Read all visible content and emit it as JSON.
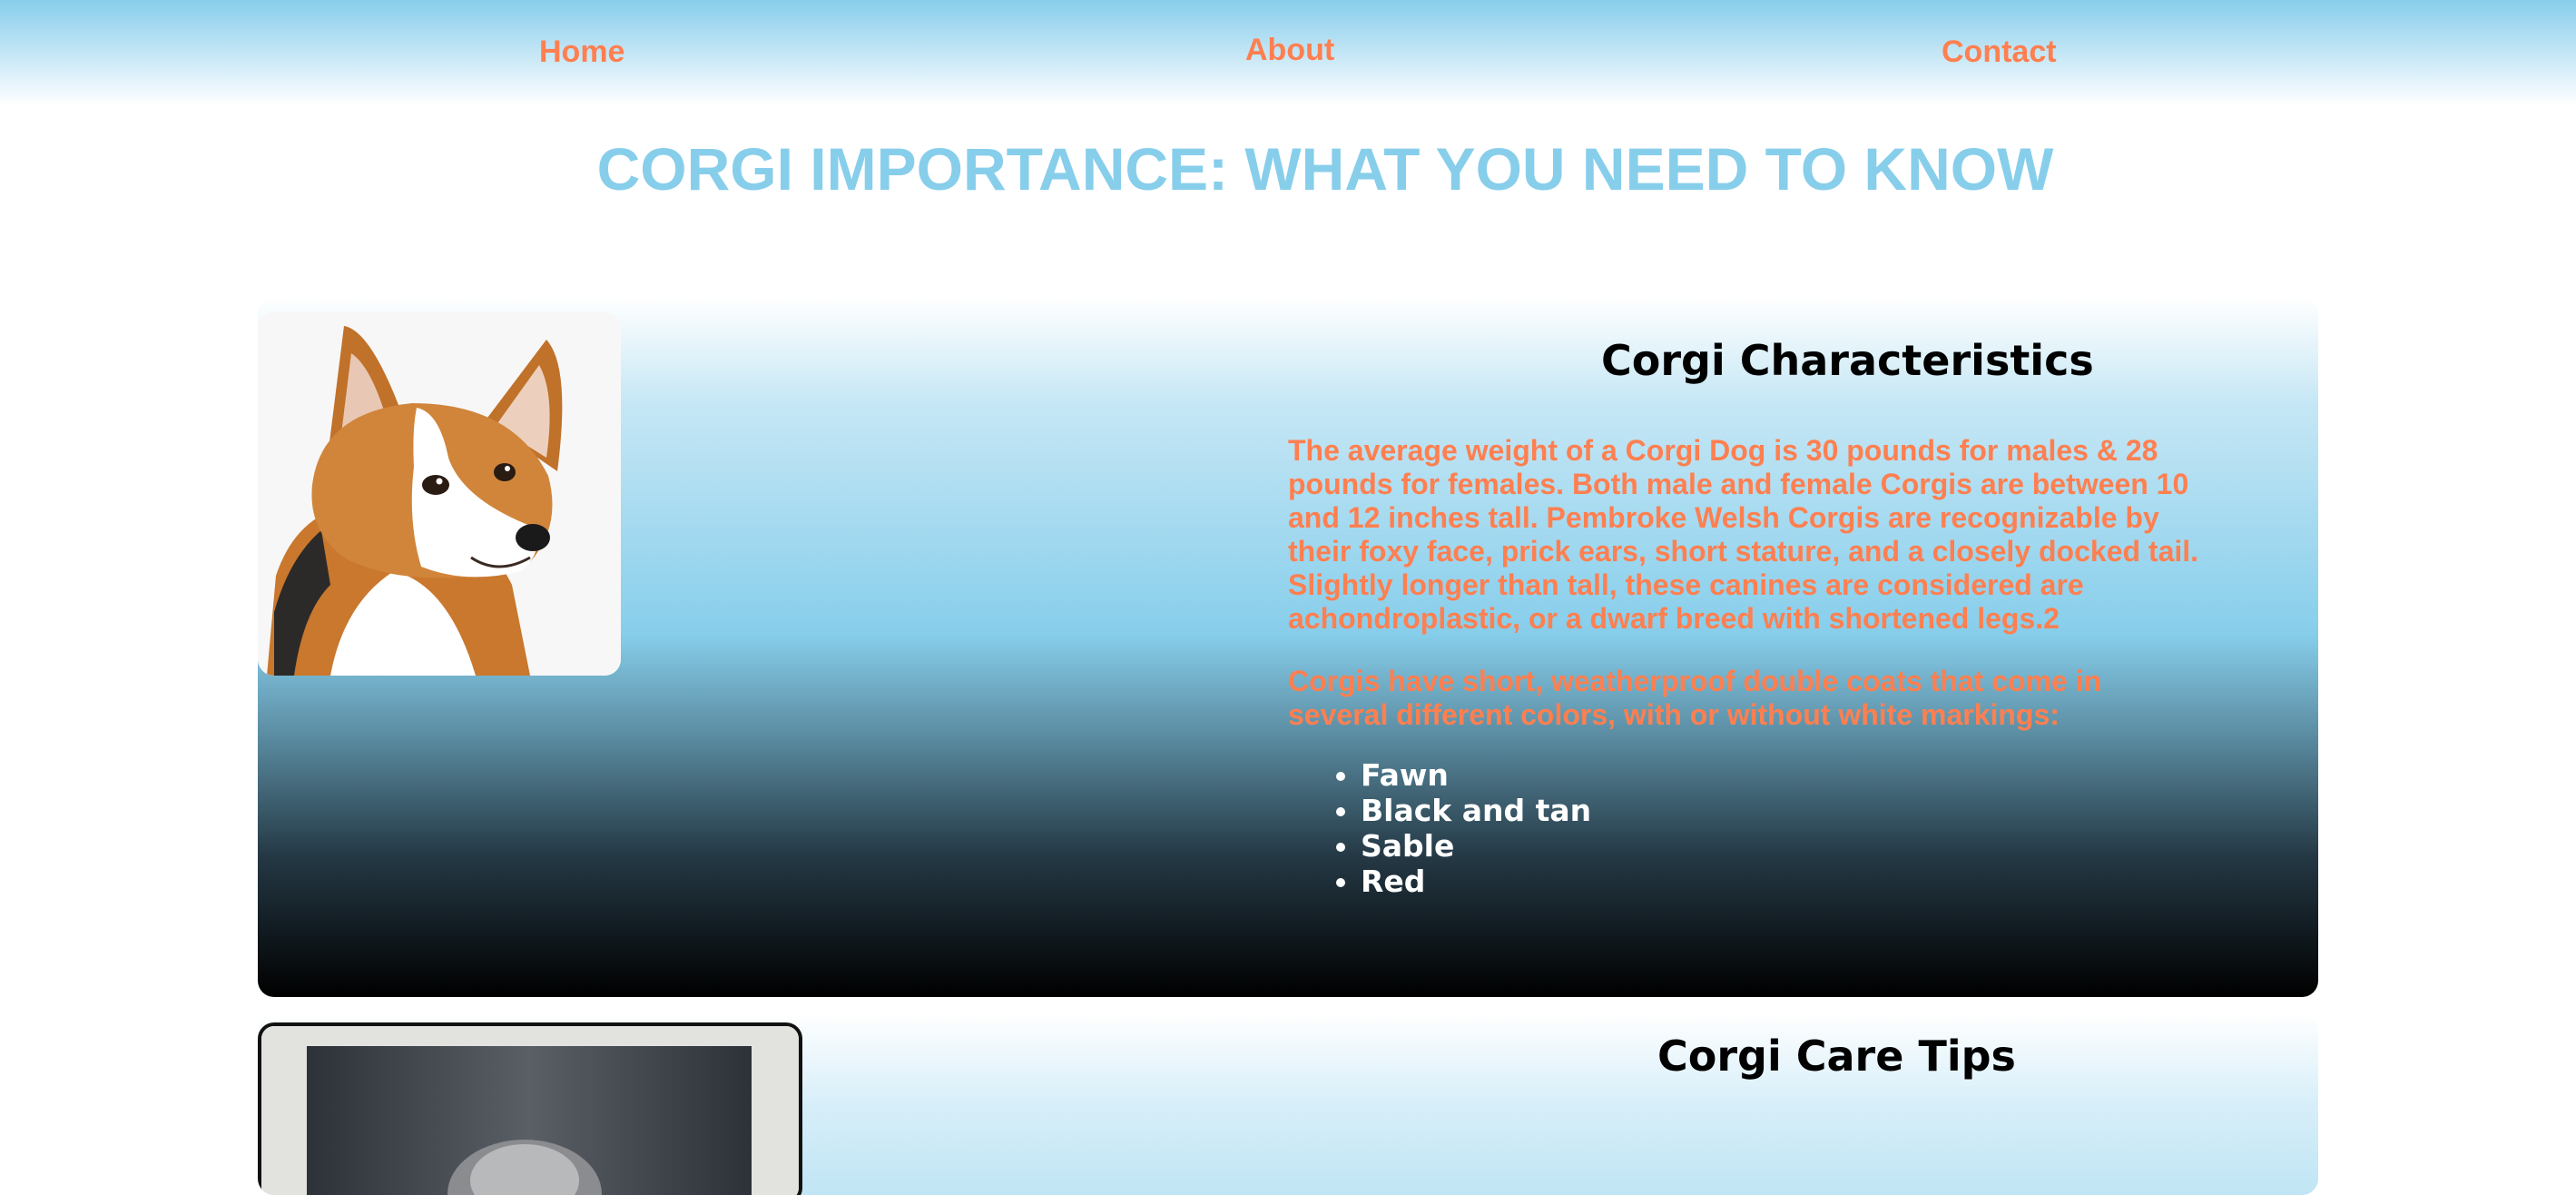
{
  "nav": {
    "home": "Home",
    "about": "About",
    "contact": "Contact"
  },
  "page": {
    "title": "CORGI IMPORTANCE: WHAT YOU NEED TO KNOW"
  },
  "characteristics": {
    "heading": "Corgi Characteristics",
    "paragraph_1": "The average weight of a Corgi Dog is 30 pounds for males & 28 pounds for females. Both male and female Corgis are between 10 and 12 inches tall. Pembroke Welsh Corgis are recognizable by their foxy face, prick ears, short stature, and a closely docked tail. Slightly longer than tall, these canines are considered are achondroplastic, or a dwarf breed with shortened legs.2",
    "paragraph_2": "Corgis have short, weatherproof double coats that come in several different colors, with or without white markings:",
    "colors": [
      "Fawn",
      "Black and tan",
      "Sable",
      "Red"
    ]
  },
  "care": {
    "heading": "Corgi Care Tips"
  },
  "theme": {
    "accent": "#ff7f50",
    "sky": "#87ceeb",
    "text_dark": "#000000",
    "list_text": "#ffffff"
  }
}
